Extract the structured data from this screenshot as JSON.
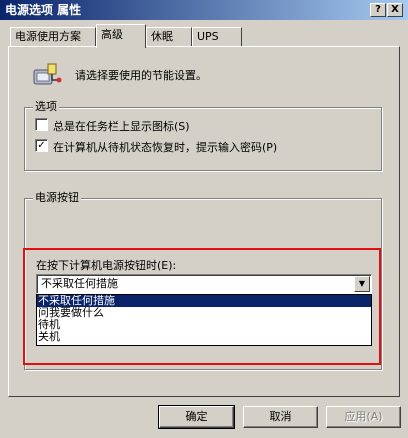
{
  "window": {
    "title": "电源选项 属性",
    "help_button": "?",
    "close_button": "X"
  },
  "tabs": [
    {
      "label": "电源使用方案",
      "active": false
    },
    {
      "label": "高级",
      "active": true
    },
    {
      "label": "休眠",
      "active": false
    },
    {
      "label": "UPS",
      "active": false
    }
  ],
  "header": {
    "icon": "power-settings-icon",
    "text": "请选择要使用的节能设置。"
  },
  "options": {
    "legend": "选项",
    "items": [
      {
        "label": "总是在任务栏上显示图标(S)",
        "checked": false
      },
      {
        "label": "在计算机从待机状态恢复时，提示输入密码(P)",
        "checked": true
      }
    ]
  },
  "power_buttons": {
    "legend": "电源按钮",
    "label": "在按下计算机电源按钮时(E):",
    "selected": "不采取任何措施",
    "options": [
      "不采取任何措施",
      "问我要做什么",
      "待机",
      "关机"
    ]
  },
  "footer": {
    "ok": "确定",
    "cancel": "取消",
    "apply": "应用(A)"
  },
  "colors": {
    "titlebar_start": "#0a246a",
    "titlebar_end": "#a6caf0",
    "highlight": "#e01010",
    "selection": "#0a246a"
  }
}
